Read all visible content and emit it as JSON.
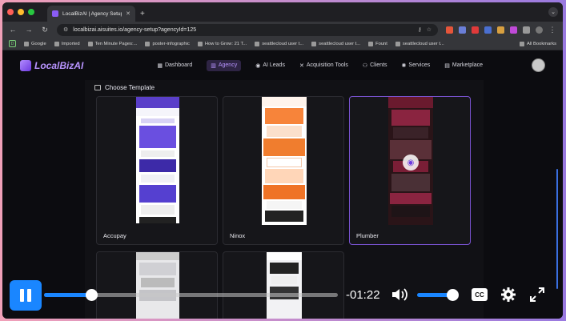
{
  "browser": {
    "tab_title": "LocalBizAI | Agency Setup",
    "url": "localbizai.aisuites.io/agency-setup?agencyId=125",
    "bookmarks": [
      "Google",
      "Imported",
      "Ten Minute Pages:...",
      "poster-infographic",
      "How to Grow: 21 T...",
      "seattlecloud user t...",
      "seattlecloud user t...",
      "Fount",
      "seattlecloud user t..."
    ],
    "all_bookmarks": "All Bookmarks"
  },
  "app": {
    "logo": "LocalBizAI",
    "menu": [
      {
        "label": "Dashboard",
        "icon": "grid-icon"
      },
      {
        "label": "Agency",
        "icon": "building-icon"
      },
      {
        "label": "AI Leads",
        "icon": "ai-icon"
      },
      {
        "label": "Acquisition Tools",
        "icon": "tools-icon"
      },
      {
        "label": "Clients",
        "icon": "users-icon"
      },
      {
        "label": "Services",
        "icon": "services-icon"
      },
      {
        "label": "Marketplace",
        "icon": "store-icon"
      }
    ],
    "section_title": "Choose Template",
    "templates": [
      {
        "label": "Accupay",
        "selected": false
      },
      {
        "label": "Ninox",
        "selected": false
      },
      {
        "label": "Plumber",
        "selected": true
      }
    ]
  },
  "player": {
    "time_remaining": "-01:22",
    "progress": 0.16,
    "volume": 0.9,
    "cc_label": "CC",
    "accent": "#1a86ff"
  }
}
